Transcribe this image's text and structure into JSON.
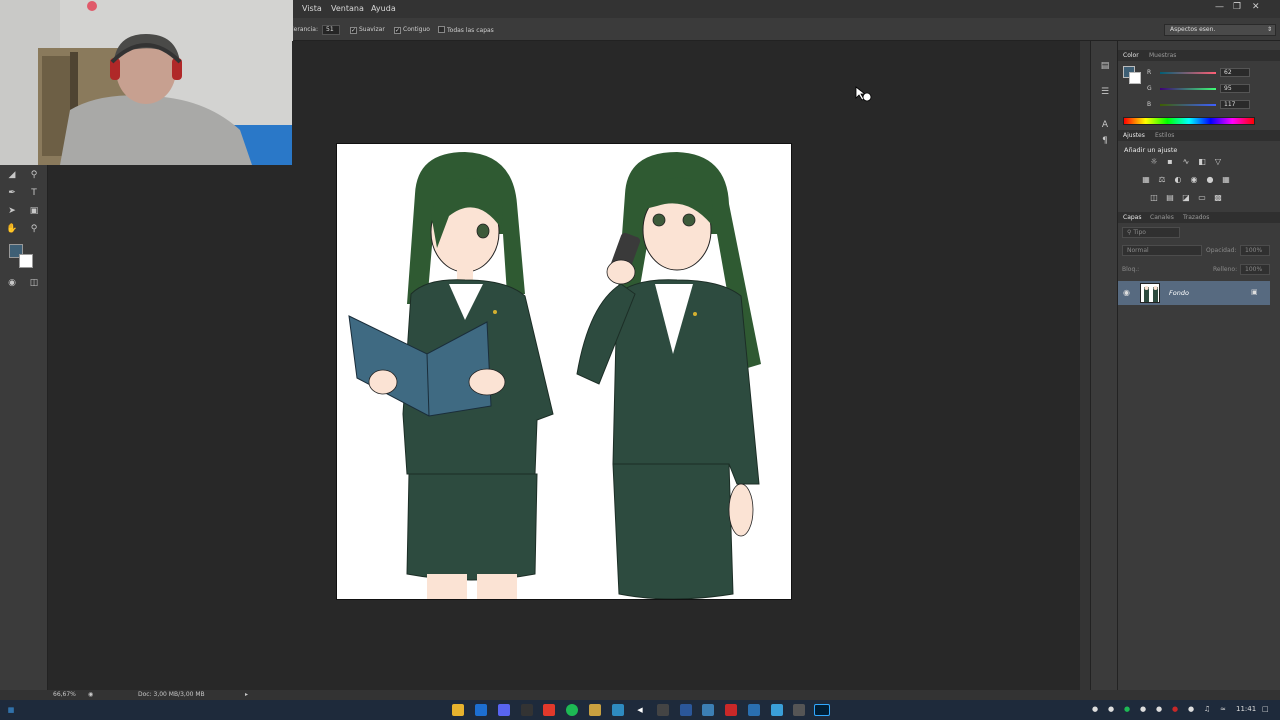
{
  "menu": {
    "items": [
      "Vista",
      "Ventana",
      "Ayuda"
    ]
  },
  "options_bar": {
    "tolerance_label": "lerancia:",
    "tolerance_value": "51",
    "smooth_label": "Suavizar",
    "contiguous_label": "Contiguo",
    "all_layers_label": "Todas las capas",
    "workspace": "Aspectos esen."
  },
  "color_panel": {
    "tabs": [
      "Color",
      "Muestras"
    ],
    "r_label": "R",
    "r_value": "62",
    "g_label": "G",
    "g_value": "95",
    "b_label": "B",
    "b_value": "117",
    "foreground": "#3e5f75"
  },
  "adjustments_panel": {
    "tabs": [
      "Ajustes",
      "Estilos"
    ],
    "title": "Añadir un ajuste"
  },
  "layers_panel": {
    "tabs": [
      "Capas",
      "Canales",
      "Trazados"
    ],
    "filter_label": "Tipo",
    "blend_mode": "Normal",
    "opacity_label": "Opacidad:",
    "opacity_value": "100%",
    "lock_label": "Bloq.:",
    "fill_label": "Relleno:",
    "fill_value": "100%",
    "layer_name": "Fondo"
  },
  "status": {
    "zoom": "66,67%",
    "doc_info": "Doc: 3,00 MB/3,00 MB"
  },
  "taskbar": {
    "time": "11:41"
  },
  "colors": {
    "suit": "#2d4b3f",
    "hair": "#2f5a32",
    "book": "#3f6a82",
    "accent": "#3e5f75"
  }
}
